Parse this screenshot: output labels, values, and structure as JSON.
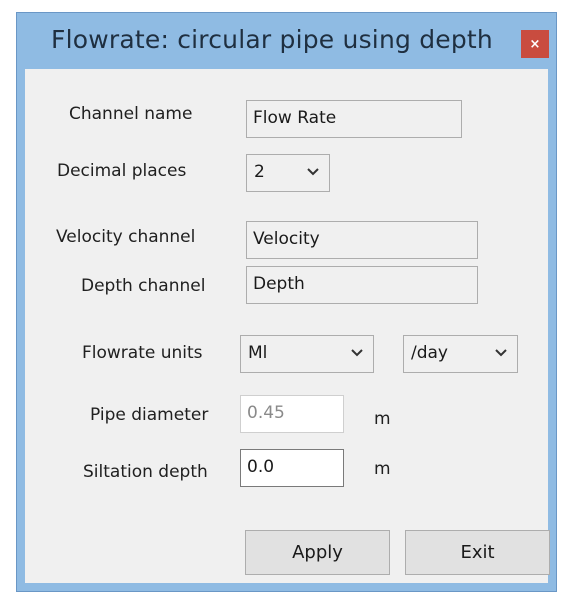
{
  "window": {
    "title": "Flowrate: circular pipe using depth"
  },
  "close_glyph": "×",
  "form": {
    "channel_name_label": "Channel name",
    "channel_name_value": "Flow Rate",
    "decimal_places_label": "Decimal places",
    "decimal_places_value": "2",
    "velocity_channel_label": "Velocity channel",
    "velocity_channel_value": "Velocity",
    "depth_channel_label": "Depth channel",
    "depth_channel_value": "Depth",
    "flowrate_units_label": "Flowrate units",
    "flowrate_units_value": "Ml",
    "flowrate_period_value": "/day",
    "pipe_diameter_label": "Pipe diameter",
    "pipe_diameter_value": "0.45",
    "pipe_diameter_unit": "m",
    "siltation_depth_label": "Siltation depth",
    "siltation_depth_value": "0.0",
    "siltation_depth_unit": "m"
  },
  "buttons": {
    "apply": "Apply",
    "exit": "Exit"
  },
  "colors": {
    "title_bar": "#8fbbe3",
    "close_button": "#c94c3f",
    "client": "#f0f0f0"
  }
}
